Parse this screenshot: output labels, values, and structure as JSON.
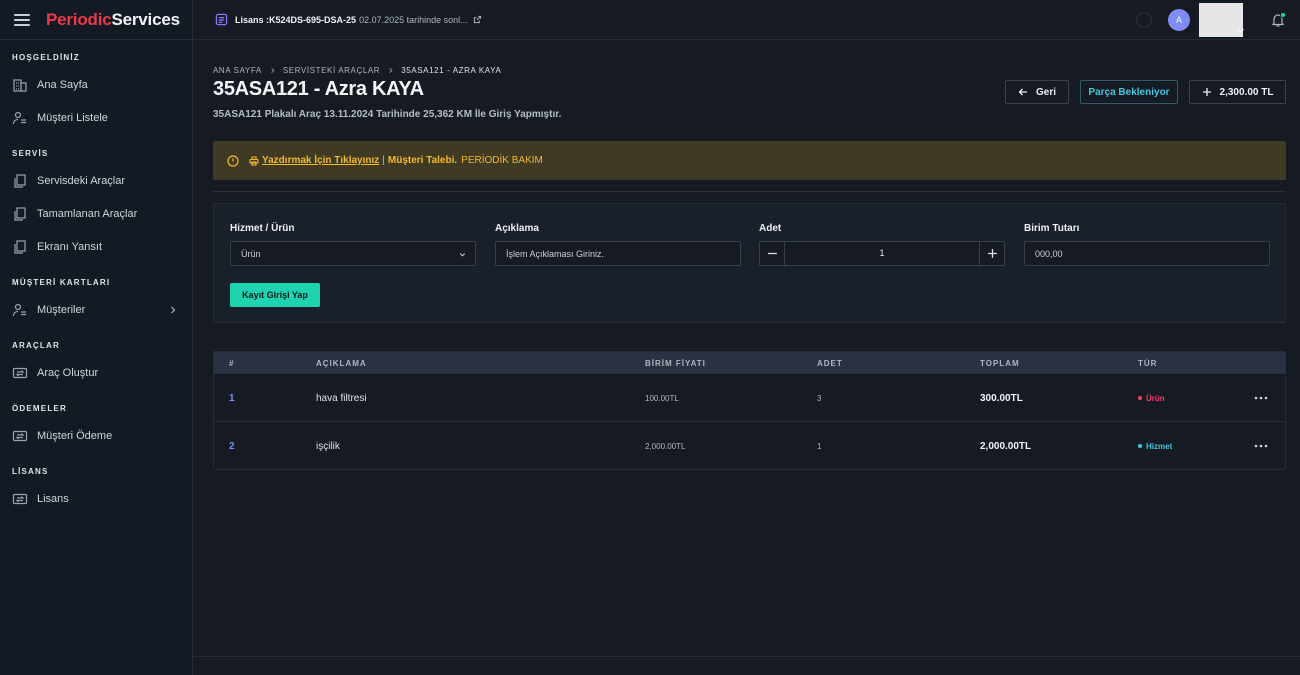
{
  "brand": {
    "part1": "Periodic",
    "part2": "Services"
  },
  "topbar": {
    "license_key": "Lisans :K524DS-695-DSA-25",
    "license_date": "02.07.2025 tarihinde sonl...",
    "avatar_letter": "A"
  },
  "sidebar": {
    "sections": [
      {
        "title": "HOŞGELDİNİZ",
        "items": [
          {
            "label": "Ana Sayfa",
            "icon": "building-icon"
          },
          {
            "label": "Müşteri Listele",
            "icon": "user-list-icon"
          }
        ]
      },
      {
        "title": "SERVİS",
        "items": [
          {
            "label": "Servisdeki Araçlar",
            "icon": "copy-icon"
          },
          {
            "label": "Tamamlanan Araçlar",
            "icon": "copy-icon"
          },
          {
            "label": "Ekranı Yansıt",
            "icon": "copy-icon"
          }
        ]
      },
      {
        "title": "MÜŞTERİ KARTLARI",
        "items": [
          {
            "label": "Müşteriler",
            "icon": "user-list-icon"
          }
        ]
      },
      {
        "title": "ARAÇLAR",
        "items": [
          {
            "label": "Araç Oluştur",
            "icon": "swap-icon"
          }
        ]
      },
      {
        "title": "ÖDEMELER",
        "items": [
          {
            "label": "Müşteri Ödeme",
            "icon": "swap-icon"
          }
        ]
      },
      {
        "title": "LİSANS",
        "items": [
          {
            "label": "Lisans",
            "icon": "swap-icon"
          }
        ]
      }
    ]
  },
  "breadcrumb": {
    "home": "ANA SAYFA",
    "section": "SERVİSTEKİ ARAÇLAR",
    "current": "35ASA121 - AZRA KAYA"
  },
  "page": {
    "title": "35ASA121 - Azra KAYA",
    "subtitle": "35ASA121 Plakalı Araç 13.11.2024 Tarihinde 25,362 KM İle Giriş Yapmıştır."
  },
  "actions": {
    "back": "Geri",
    "parts": "Parça Bekleniyor",
    "total": "2,300.00 TL"
  },
  "alert": {
    "print_link": "Yazdırmak İçin Tıklayınız",
    "pipe": "|",
    "request_label": "Müşteri Talebi.",
    "request_value": "PERİODİK BAKIM"
  },
  "form": {
    "service_label": "Hizmet / Ürün",
    "service_value": "Ürün",
    "desc_label": "Açıklama",
    "desc_placeholder": "İşlem Açıklaması Giriniz.",
    "qty_label": "Adet",
    "qty_value": "1",
    "price_label": "Birim Tutarı",
    "price_value": "000,00",
    "submit": "Kayıt Girişi Yap"
  },
  "table": {
    "headers": [
      "#",
      "AÇIKLAMA",
      "BİRİM FİYATI",
      "ADET",
      "TOPLAM",
      "TÜR"
    ],
    "rows": [
      {
        "idx": "1",
        "desc": "hava filtresi",
        "unit": "100.00TL",
        "qty": "3",
        "total": "300.00TL",
        "type": "Ürün",
        "type_color": "#f1416c"
      },
      {
        "idx": "2",
        "desc": "işçilik",
        "unit": "2,000.00TL",
        "qty": "1",
        "total": "2,000.00TL",
        "type": "Hizmet",
        "type_color": "#3ec6e0"
      }
    ]
  },
  "colors": {
    "accent": "#1ed4b0",
    "brand_red": "#e83a4a",
    "warning": "#f5b82e",
    "index_blue": "#7f8cf5"
  }
}
